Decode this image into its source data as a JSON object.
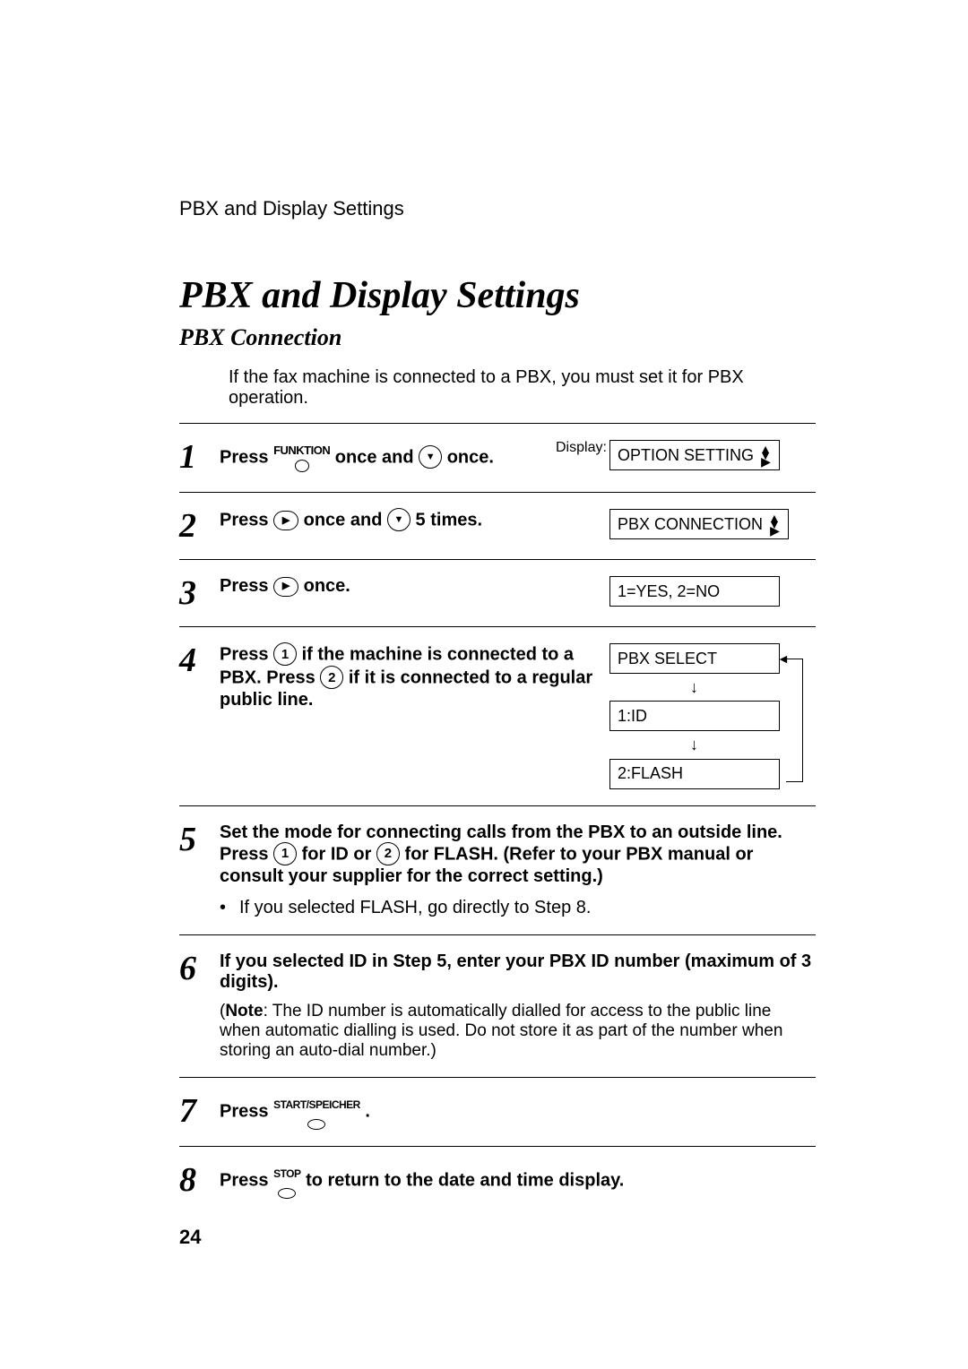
{
  "running_header": "PBX and Display Settings",
  "title": "PBX and Display Settings",
  "subtitle": "PBX Connection",
  "intro": "If the fax machine is connected to a PBX, you must set it for PBX operation.",
  "display_label": "Display:",
  "page_number": "24",
  "keys": {
    "funktion": "FUNKTION",
    "start": "START/SPEICHER",
    "stop": "STOP"
  },
  "steps": {
    "s1": {
      "num": "1",
      "text_a": "Press ",
      "text_b": " once and ",
      "text_c": " once.",
      "display": "OPTION SETTING"
    },
    "s2": {
      "num": "2",
      "text_a": "Press ",
      "text_b": " once and ",
      "text_c": " 5 times.",
      "display": "PBX CONNECTION"
    },
    "s3": {
      "num": "3",
      "text_a": "Press ",
      "text_b": " once.",
      "display": "1=YES, 2=NO"
    },
    "s4": {
      "num": "4",
      "text_a": "Press ",
      "text_b": " if the machine is connected to a PBX. Press ",
      "text_c": " if it is connected to a regular public line.",
      "displays": {
        "d1": "PBX SELECT",
        "d2": "1:ID",
        "d3": "2:FLASH"
      }
    },
    "s5": {
      "num": "5",
      "text_a": "Set the mode for connecting calls from the PBX to an outside line. Press ",
      "text_b": " for ID or ",
      "text_c": " for FLASH. (Refer to your PBX manual or consult your supplier for the correct setting.)",
      "bullet": "If you selected FLASH, go directly to Step 8."
    },
    "s6": {
      "num": "6",
      "text": "If you selected ID in Step 5, enter your PBX ID number (maximum of 3 digits).",
      "note_label": "Note",
      "note_text": ": The ID number is automatically dialled for access to the public line when automatic dialling is used. Do not store it as part of the number when storing an auto-dial number.)"
    },
    "s7": {
      "num": "7",
      "text_a": "Press ",
      "text_b": " ."
    },
    "s8": {
      "num": "8",
      "text_a": "Press ",
      "text_b": " to return to the date and time display."
    }
  }
}
